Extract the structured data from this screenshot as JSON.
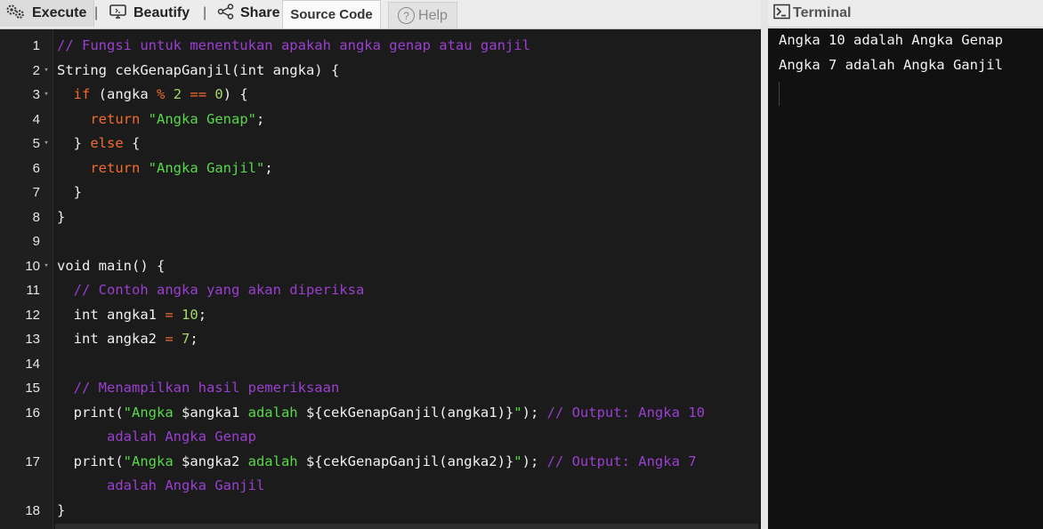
{
  "toolbar": {
    "execute_label": "Execute",
    "beautify_label": "Beautify",
    "share_label": "Share",
    "separator": "|",
    "source_tab_label": "Source Code",
    "help_tab_label": "Help"
  },
  "editor": {
    "lines": [
      {
        "num": "1",
        "fold": false
      },
      {
        "num": "2",
        "fold": true
      },
      {
        "num": "3",
        "fold": true
      },
      {
        "num": "4",
        "fold": false
      },
      {
        "num": "5",
        "fold": true
      },
      {
        "num": "6",
        "fold": false
      },
      {
        "num": "7",
        "fold": false
      },
      {
        "num": "8",
        "fold": false
      },
      {
        "num": "9",
        "fold": false
      },
      {
        "num": "10",
        "fold": true
      },
      {
        "num": "11",
        "fold": false
      },
      {
        "num": "12",
        "fold": false
      },
      {
        "num": "13",
        "fold": false
      },
      {
        "num": "14",
        "fold": false
      },
      {
        "num": "15",
        "fold": false
      },
      {
        "num": "16",
        "fold": false
      },
      {
        "num": "17",
        "fold": false
      },
      {
        "num": "18",
        "fold": false
      }
    ],
    "code": [
      [
        [
          "comment",
          "// Fungsi untuk menentukan apakah angka genap atau ganjil"
        ]
      ],
      [
        [
          "",
          "String cekGenapGanjil(int angka) {"
        ]
      ],
      [
        [
          "",
          "  "
        ],
        [
          "kw",
          "if"
        ],
        [
          "",
          " (angka "
        ],
        [
          "op",
          "%"
        ],
        [
          "",
          " "
        ],
        [
          "num",
          "2"
        ],
        [
          "",
          " "
        ],
        [
          "op",
          "=="
        ],
        [
          "",
          " "
        ],
        [
          "num",
          "0"
        ],
        [
          "",
          ") {"
        ]
      ],
      [
        [
          "",
          "    "
        ],
        [
          "kw",
          "return"
        ],
        [
          "",
          " "
        ],
        [
          "str",
          "\"Angka Genap\""
        ],
        [
          "",
          ";"
        ]
      ],
      [
        [
          "",
          "  } "
        ],
        [
          "kw",
          "else"
        ],
        [
          "",
          " {"
        ]
      ],
      [
        [
          "",
          "    "
        ],
        [
          "kw",
          "return"
        ],
        [
          "",
          " "
        ],
        [
          "str",
          "\"Angka Ganjil\""
        ],
        [
          "",
          ";"
        ]
      ],
      [
        [
          "",
          "  }"
        ]
      ],
      [
        [
          "",
          "}"
        ]
      ],
      [
        [
          "",
          ""
        ]
      ],
      [
        [
          "",
          "void main() {"
        ]
      ],
      [
        [
          "",
          "  "
        ],
        [
          "comment",
          "// Contoh angka yang akan diperiksa"
        ]
      ],
      [
        [
          "",
          "  int angka1 "
        ],
        [
          "op",
          "="
        ],
        [
          "",
          " "
        ],
        [
          "num",
          "10"
        ],
        [
          "",
          ";"
        ]
      ],
      [
        [
          "",
          "  int angka2 "
        ],
        [
          "op",
          "="
        ],
        [
          "",
          " "
        ],
        [
          "num",
          "7"
        ],
        [
          "",
          ";"
        ]
      ],
      [
        [
          "",
          ""
        ]
      ],
      [
        [
          "",
          "  "
        ],
        [
          "comment",
          "// Menampilkan hasil pemeriksaan"
        ]
      ],
      [
        [
          "",
          "  print("
        ],
        [
          "str",
          "\"Angka "
        ],
        [
          "",
          "$angka1"
        ],
        [
          "str",
          " adalah "
        ],
        [
          "",
          "${cekGenapGanjil(angka1)}"
        ],
        [
          "str",
          "\""
        ],
        [
          "",
          "); "
        ],
        [
          "comment",
          "// Output: Angka 10"
        ]
      ],
      [
        [
          "comment",
          "      adalah Angka Genap"
        ]
      ],
      [
        [
          "",
          "  print("
        ],
        [
          "str",
          "\"Angka "
        ],
        [
          "",
          "$angka2"
        ],
        [
          "str",
          " adalah "
        ],
        [
          "",
          "${cekGenapGanjil(angka2)}"
        ],
        [
          "str",
          "\""
        ],
        [
          "",
          "); "
        ],
        [
          "comment",
          "// Output: Angka 7"
        ]
      ],
      [
        [
          "comment",
          "      adalah Angka Ganjil"
        ]
      ],
      [
        [
          "",
          "}"
        ]
      ]
    ]
  },
  "terminal": {
    "title": "Terminal",
    "output": [
      "Angka 10 adalah Angka Genap",
      "Angka 7 adalah Angka Ganjil"
    ]
  },
  "icons": {
    "execute": "gears-icon",
    "beautify": "monitor-icon",
    "share": "share-icon",
    "help": "question-circle-icon",
    "terminal": "terminal-icon"
  }
}
